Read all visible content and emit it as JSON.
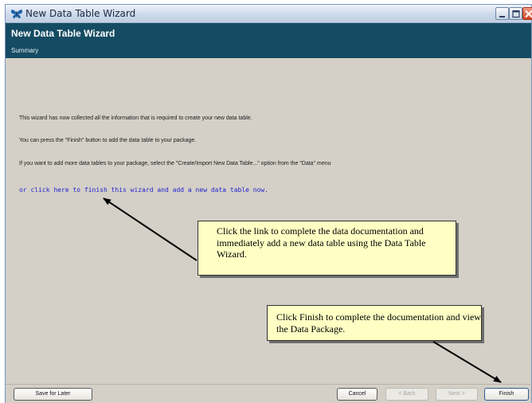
{
  "window": {
    "title": "New Data Table Wizard",
    "icon": "butterfly-icon",
    "controls": [
      "minimize-icon",
      "maximize-icon",
      "close-icon"
    ]
  },
  "header": {
    "title": "New Data Table Wizard",
    "subtitle": "Summary",
    "background": "#154c63"
  },
  "content": {
    "paragraphs": [
      "This wizard has now collected all the information that is required to create your new data table.",
      "You can press the \"Finish\" button to add the data table to your package.",
      "If you want to add more data tables to your package, select the \"Create/Import New Data Table...\" option from the \"Data\" menu"
    ],
    "link": "or click here to finish this wizard and add a new data table now.",
    "link_color": "#1f1fcc"
  },
  "callouts": {
    "link_callout": "Click the link to complete the data documentation and immediately add a new data table using the Data Table Wizard.",
    "finish_callout": "Click Finish to complete the documentation and view the Data Package.",
    "background": "#ffffc4"
  },
  "footer": {
    "save_later": "Save for Later",
    "cancel": "Cancel",
    "back": "< Back",
    "next": "Next >",
    "finish": "Finish"
  }
}
